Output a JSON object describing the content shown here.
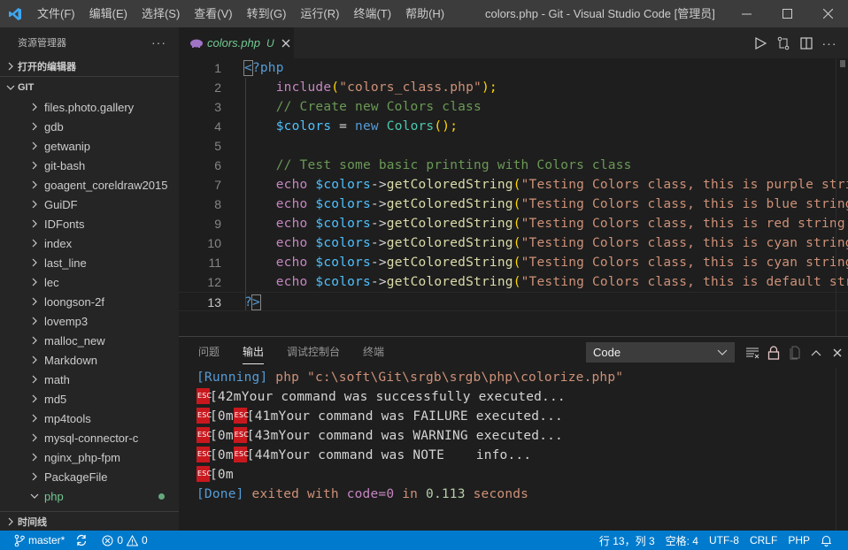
{
  "titlebar": {
    "menu": [
      "文件(F)",
      "编辑(E)",
      "选择(S)",
      "查看(V)",
      "转到(G)",
      "运行(R)",
      "终端(T)",
      "帮助(H)"
    ],
    "title": "colors.php - Git - Visual Studio Code [管理员]"
  },
  "sidebar": {
    "header": "资源管理器",
    "more": "···",
    "open_editors": "打开的编辑器",
    "root": "GIT",
    "folders": [
      {
        "label": "files.photo.gallery",
        "expanded": false
      },
      {
        "label": "gdb",
        "expanded": false
      },
      {
        "label": "getwanip",
        "expanded": false
      },
      {
        "label": "git-bash",
        "expanded": false
      },
      {
        "label": "goagent_coreldraw2015",
        "expanded": false
      },
      {
        "label": "GuiDF",
        "expanded": false
      },
      {
        "label": "IDFonts",
        "expanded": false
      },
      {
        "label": "index",
        "expanded": false
      },
      {
        "label": "last_line",
        "expanded": false
      },
      {
        "label": "lec",
        "expanded": false
      },
      {
        "label": "loongson-2f",
        "expanded": false
      },
      {
        "label": "lovemp3",
        "expanded": false
      },
      {
        "label": "malloc_new",
        "expanded": false
      },
      {
        "label": "Markdown",
        "expanded": false
      },
      {
        "label": "math",
        "expanded": false
      },
      {
        "label": "md5",
        "expanded": false
      },
      {
        "label": "mp4tools",
        "expanded": false
      },
      {
        "label": "mysql-connector-c",
        "expanded": false
      },
      {
        "label": "nginx_php-fpm",
        "expanded": false
      },
      {
        "label": "PackageFile",
        "expanded": false
      },
      {
        "label": "php",
        "expanded": true,
        "modified": true
      }
    ],
    "timeline": "时间线"
  },
  "editor": {
    "tab": {
      "name": "colors.php",
      "badge": "U"
    },
    "lines": [
      {
        "n": "1"
      },
      {
        "n": "2"
      },
      {
        "n": "3"
      },
      {
        "n": "4"
      },
      {
        "n": "5"
      },
      {
        "n": "6"
      },
      {
        "n": "7"
      },
      {
        "n": "8"
      },
      {
        "n": "9"
      },
      {
        "n": "10"
      },
      {
        "n": "11"
      },
      {
        "n": "12"
      },
      {
        "n": "13"
      }
    ],
    "code": {
      "l1_open": "<",
      "l1_rest": "?php",
      "l2_fn": "include",
      "l2_p1": "(",
      "l2_str": "\"colors_class.php\"",
      "l2_p2": ");",
      "l3": "// Create new Colors class",
      "l4_var": "$colors",
      "l4_eq": " = ",
      "l4_new": "new",
      "l4_cls": "Colors",
      "l4_end": "();",
      "l6": "// Test some basic printing with Colors class",
      "echo": "echo",
      "var": "$colors",
      "arrow": "->",
      "method": "getColoredString",
      "paren": "(",
      "strings": [
        "\"Testing Colors class, this is purple strin",
        "\"Testing Colors class, this is blue string ",
        "\"Testing Colors class, this is red string o",
        "\"Testing Colors class, this is cyan string ",
        "\"Testing Colors class, this is cyan string ",
        "\"Testing Colors class, this is default stri"
      ],
      "l13_q": "?",
      "l13_close": ">"
    }
  },
  "panel": {
    "tabs": [
      "问题",
      "输出",
      "调试控制台",
      "终端"
    ],
    "active_tab": "输出",
    "channel": "Code",
    "output": {
      "running_tag": "[Running]",
      "running_cmd": " php \"c:\\soft\\Git\\srgb\\srgb\\php\\colorize.php\"",
      "esc": "ESC",
      "l1": "[42mYour command was successfully executed...",
      "l2a": "[0m",
      "l2b": "[41mYour command was FAILURE executed...",
      "l3a": "[0m",
      "l3b": "[43mYour command was WARNING executed...",
      "l4a": "[0m",
      "l4b": "[44mYour command was NOTE    info...",
      "l5": "[0m",
      "done_tag": "[Done]",
      "done_exit": " exited with ",
      "done_code": "code=0",
      "done_in": " in ",
      "done_time": "0.113",
      "done_sec": " seconds"
    }
  },
  "statusbar": {
    "branch": "master*",
    "errors": "0",
    "warnings": "0",
    "position": "行 13，列 3",
    "spaces": "空格: 4",
    "encoding": "UTF-8",
    "eol": "CRLF",
    "language": "PHP"
  }
}
